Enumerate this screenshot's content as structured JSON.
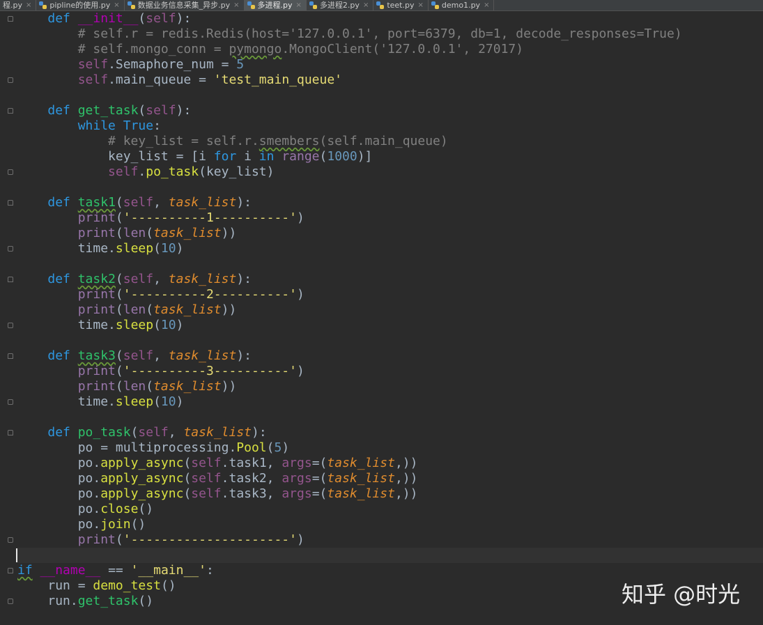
{
  "tabs": [
    {
      "label": "程.py",
      "active": false
    },
    {
      "label": "pipline的使用.py",
      "active": false
    },
    {
      "label": "数据业务信息采集_异步.py",
      "active": false
    },
    {
      "label": "多进程.py",
      "active": true
    },
    {
      "label": "多进程2.py",
      "active": false
    },
    {
      "label": "teet.py",
      "active": false
    },
    {
      "label": "demo1.py",
      "active": false
    }
  ],
  "tab_close_glyph": "×",
  "code_lines": [
    [
      [
        "    ",
        ""
      ],
      [
        "def",
        "kw2"
      ],
      [
        " ",
        ""
      ],
      [
        "__init__",
        "magic"
      ],
      [
        "(",
        ""
      ],
      [
        "self",
        "self"
      ],
      [
        "):",
        ""
      ]
    ],
    [
      [
        "        ",
        ""
      ],
      [
        "# self.r = redis.Redis(host='127.0.0.1', port=6379, db=1, decode_responses=True)",
        "cmt"
      ]
    ],
    [
      [
        "        ",
        ""
      ],
      [
        "# self.mongo_conn = ",
        "cmt"
      ],
      [
        "pymongo",
        "cmt warn"
      ],
      [
        ".MongoClient('127.0.0.1', 27017)",
        "cmt"
      ]
    ],
    [
      [
        "        ",
        ""
      ],
      [
        "self",
        "self"
      ],
      [
        ".Semaphore_num = ",
        ""
      ],
      [
        "5",
        "num"
      ]
    ],
    [
      [
        "        ",
        ""
      ],
      [
        "self",
        "self"
      ],
      [
        ".main_queue = ",
        ""
      ],
      [
        "'test_main_queue'",
        "str"
      ]
    ],
    [],
    [
      [
        "    ",
        ""
      ],
      [
        "def",
        "kw2"
      ],
      [
        " ",
        ""
      ],
      [
        "get_task",
        "fn"
      ],
      [
        "(",
        ""
      ],
      [
        "self",
        "self"
      ],
      [
        "):",
        ""
      ]
    ],
    [
      [
        "        ",
        ""
      ],
      [
        "while",
        "kw2"
      ],
      [
        " ",
        ""
      ],
      [
        "True",
        "kw2"
      ],
      [
        ":",
        ""
      ]
    ],
    [
      [
        "            ",
        ""
      ],
      [
        "# key_list = self.r.",
        "cmt"
      ],
      [
        "smembers",
        "cmt warn"
      ],
      [
        "(self.main_queue)",
        "cmt"
      ]
    ],
    [
      [
        "            ",
        ""
      ],
      [
        "key_list = [i ",
        ""
      ],
      [
        "for",
        "kw2"
      ],
      [
        " i ",
        ""
      ],
      [
        "in",
        "kw2"
      ],
      [
        " ",
        ""
      ],
      [
        "range",
        "bi"
      ],
      [
        "(",
        ""
      ],
      [
        "1000",
        "num"
      ],
      [
        ")]",
        ""
      ]
    ],
    [
      [
        "            ",
        ""
      ],
      [
        "self",
        "self"
      ],
      [
        ".",
        ""
      ],
      [
        "po_task",
        "call"
      ],
      [
        "(key_list)",
        ""
      ]
    ],
    [],
    [
      [
        "    ",
        ""
      ],
      [
        "def",
        "kw2"
      ],
      [
        " ",
        ""
      ],
      [
        "task1",
        "fn warn"
      ],
      [
        "(",
        ""
      ],
      [
        "self",
        "self"
      ],
      [
        ", ",
        ""
      ],
      [
        "task_list",
        "par"
      ],
      [
        "):",
        ""
      ]
    ],
    [
      [
        "        ",
        ""
      ],
      [
        "print",
        "bi"
      ],
      [
        "(",
        ""
      ],
      [
        "'----------1----------'",
        "str"
      ],
      [
        ")",
        ""
      ]
    ],
    [
      [
        "        ",
        ""
      ],
      [
        "print",
        "bi"
      ],
      [
        "(",
        ""
      ],
      [
        "len",
        "bi"
      ],
      [
        "(",
        ""
      ],
      [
        "task_list",
        "par"
      ],
      [
        "))",
        ""
      ]
    ],
    [
      [
        "        ",
        ""
      ],
      [
        "time.",
        ""
      ],
      [
        "sleep",
        "call"
      ],
      [
        "(",
        ""
      ],
      [
        "10",
        "num"
      ],
      [
        ")",
        ""
      ]
    ],
    [],
    [
      [
        "    ",
        ""
      ],
      [
        "def",
        "kw2"
      ],
      [
        " ",
        ""
      ],
      [
        "task2",
        "fn warn"
      ],
      [
        "(",
        ""
      ],
      [
        "self",
        "self"
      ],
      [
        ", ",
        ""
      ],
      [
        "task_list",
        "par"
      ],
      [
        "):",
        ""
      ]
    ],
    [
      [
        "        ",
        ""
      ],
      [
        "print",
        "bi"
      ],
      [
        "(",
        ""
      ],
      [
        "'----------2----------'",
        "str"
      ],
      [
        ")",
        ""
      ]
    ],
    [
      [
        "        ",
        ""
      ],
      [
        "print",
        "bi"
      ],
      [
        "(",
        ""
      ],
      [
        "len",
        "bi"
      ],
      [
        "(",
        ""
      ],
      [
        "task_list",
        "par"
      ],
      [
        "))",
        ""
      ]
    ],
    [
      [
        "        ",
        ""
      ],
      [
        "time.",
        ""
      ],
      [
        "sleep",
        "call"
      ],
      [
        "(",
        ""
      ],
      [
        "10",
        "num"
      ],
      [
        ")",
        ""
      ]
    ],
    [],
    [
      [
        "    ",
        ""
      ],
      [
        "def",
        "kw2"
      ],
      [
        " ",
        ""
      ],
      [
        "task3",
        "fn warn"
      ],
      [
        "(",
        ""
      ],
      [
        "self",
        "self"
      ],
      [
        ", ",
        ""
      ],
      [
        "task_list",
        "par"
      ],
      [
        "):",
        ""
      ]
    ],
    [
      [
        "        ",
        ""
      ],
      [
        "print",
        "bi"
      ],
      [
        "(",
        ""
      ],
      [
        "'----------3----------'",
        "str"
      ],
      [
        ")",
        ""
      ]
    ],
    [
      [
        "        ",
        ""
      ],
      [
        "print",
        "bi"
      ],
      [
        "(",
        ""
      ],
      [
        "len",
        "bi"
      ],
      [
        "(",
        ""
      ],
      [
        "task_list",
        "par"
      ],
      [
        "))",
        ""
      ]
    ],
    [
      [
        "        ",
        ""
      ],
      [
        "time.",
        ""
      ],
      [
        "sleep",
        "call"
      ],
      [
        "(",
        ""
      ],
      [
        "10",
        "num"
      ],
      [
        ")",
        ""
      ]
    ],
    [],
    [
      [
        "    ",
        ""
      ],
      [
        "def",
        "kw2"
      ],
      [
        " ",
        ""
      ],
      [
        "po_task",
        "fn"
      ],
      [
        "(",
        ""
      ],
      [
        "self",
        "self"
      ],
      [
        ", ",
        ""
      ],
      [
        "task_list",
        "par"
      ],
      [
        "):",
        ""
      ]
    ],
    [
      [
        "        ",
        ""
      ],
      [
        "po = multiprocessing.",
        ""
      ],
      [
        "Pool",
        "call"
      ],
      [
        "(",
        ""
      ],
      [
        "5",
        "num"
      ],
      [
        ")",
        ""
      ]
    ],
    [
      [
        "        ",
        ""
      ],
      [
        "po.",
        ""
      ],
      [
        "apply_async",
        "call"
      ],
      [
        "(",
        ""
      ],
      [
        "self",
        "self"
      ],
      [
        ".task1, ",
        ""
      ],
      [
        "args",
        "self"
      ],
      [
        "=(",
        ""
      ],
      [
        "task_list",
        "par"
      ],
      [
        ",))",
        ""
      ]
    ],
    [
      [
        "        ",
        ""
      ],
      [
        "po.",
        ""
      ],
      [
        "apply_async",
        "call"
      ],
      [
        "(",
        ""
      ],
      [
        "self",
        "self"
      ],
      [
        ".task2, ",
        ""
      ],
      [
        "args",
        "self"
      ],
      [
        "=(",
        ""
      ],
      [
        "task_list",
        "par"
      ],
      [
        ",))",
        ""
      ]
    ],
    [
      [
        "        ",
        ""
      ],
      [
        "po.",
        ""
      ],
      [
        "apply_async",
        "call"
      ],
      [
        "(",
        ""
      ],
      [
        "self",
        "self"
      ],
      [
        ".task3, ",
        ""
      ],
      [
        "args",
        "self"
      ],
      [
        "=(",
        ""
      ],
      [
        "task_list",
        "par"
      ],
      [
        ",))",
        ""
      ]
    ],
    [
      [
        "        ",
        ""
      ],
      [
        "po.",
        ""
      ],
      [
        "close",
        "call"
      ],
      [
        "()",
        ""
      ]
    ],
    [
      [
        "        ",
        ""
      ],
      [
        "po.",
        ""
      ],
      [
        "join",
        "call"
      ],
      [
        "()",
        ""
      ]
    ],
    [
      [
        "        ",
        ""
      ],
      [
        "print",
        "bi"
      ],
      [
        "(",
        ""
      ],
      [
        "'---------------------'",
        "str"
      ],
      [
        ")",
        ""
      ]
    ],
    [],
    [
      [
        "if",
        "kw2 warn"
      ],
      [
        " ",
        ""
      ],
      [
        "__name__",
        "magic"
      ],
      [
        " == ",
        ""
      ],
      [
        "'__main__'",
        "str"
      ],
      [
        ":",
        ""
      ]
    ],
    [
      [
        "    ",
        ""
      ],
      [
        "run = ",
        ""
      ],
      [
        "demo_test",
        "call"
      ],
      [
        "()",
        ""
      ]
    ],
    [
      [
        "    ",
        ""
      ],
      [
        "run.",
        ""
      ],
      [
        "get_task",
        "fn"
      ],
      [
        "()",
        ""
      ]
    ]
  ],
  "watermark": "知乎 @时光",
  "colors": {
    "background": "#2b2b2b",
    "keyword": "#2e97e0",
    "function_name": "#2fc26a",
    "string": "#e6db74",
    "comment": "#808080",
    "parameter": "#e08c2e",
    "self": "#94558d"
  }
}
